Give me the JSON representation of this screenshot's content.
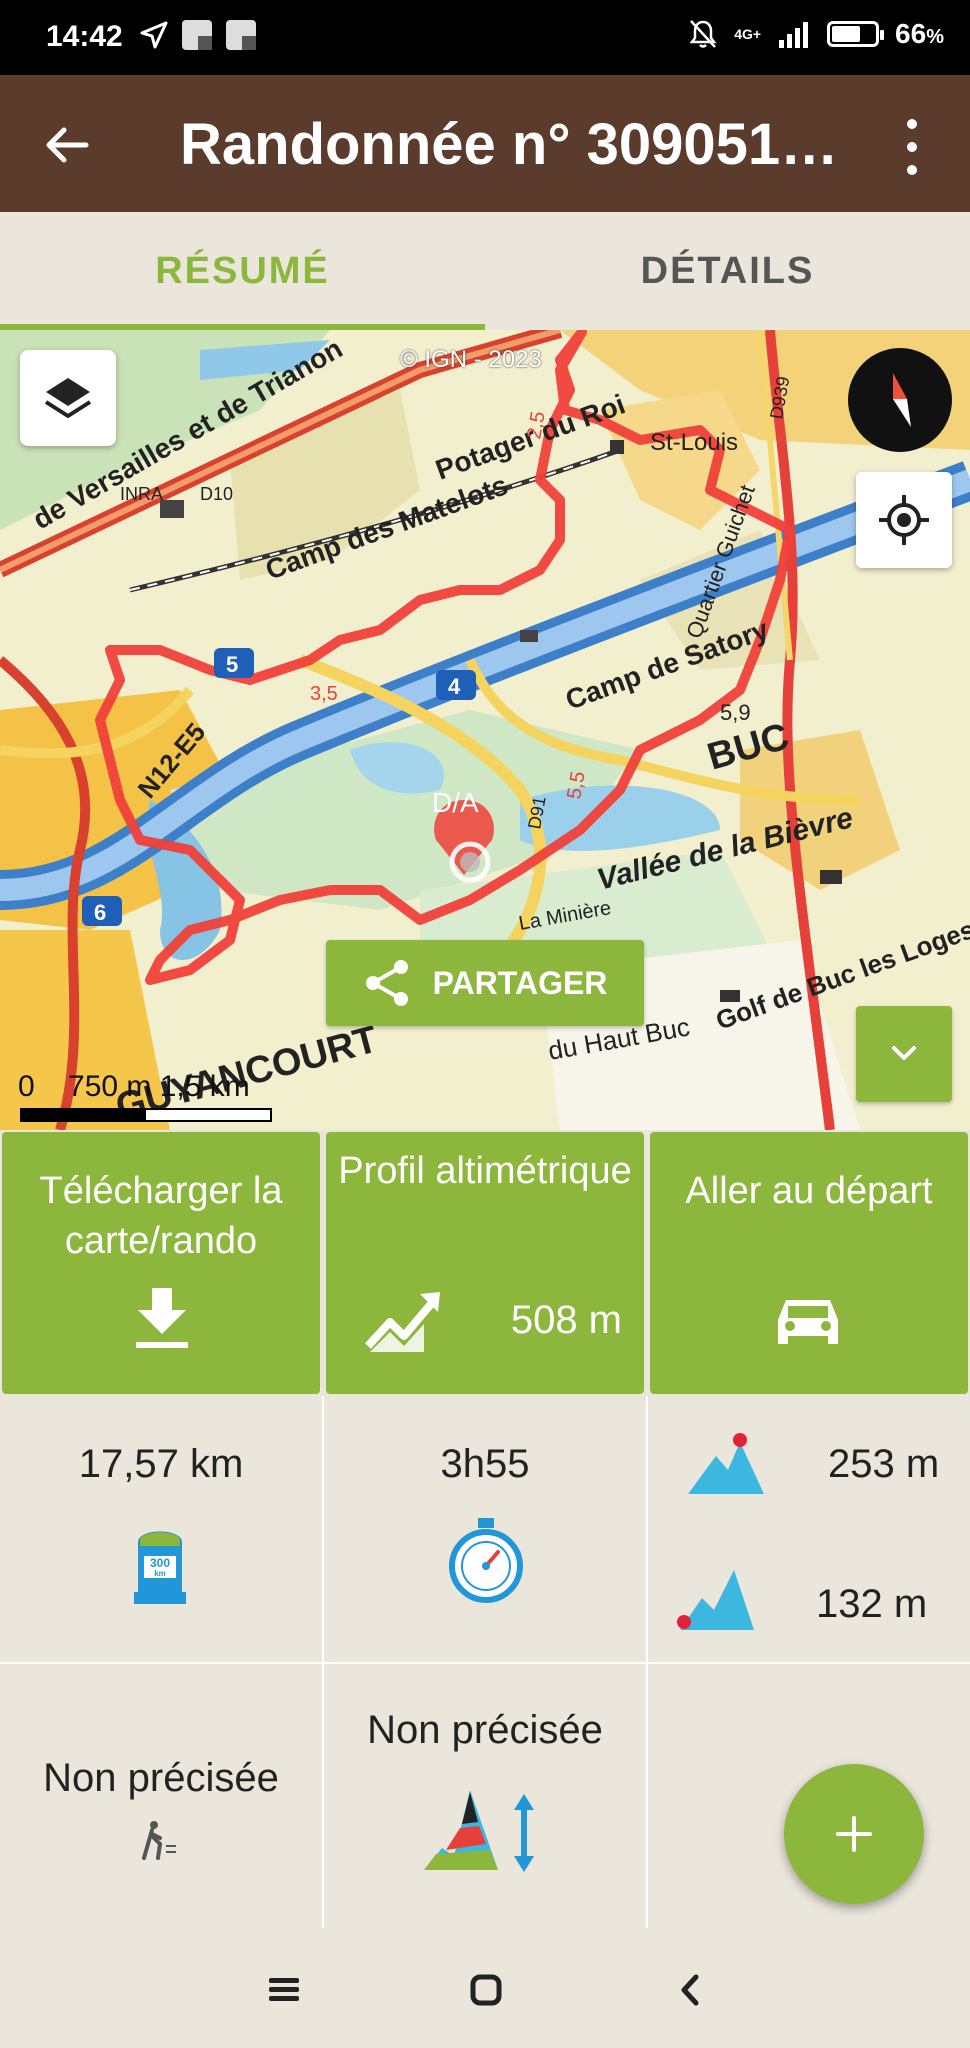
{
  "status_bar": {
    "time": "14:42",
    "network": "4G+",
    "battery": "66",
    "battery_unit": "%"
  },
  "app_bar": {
    "title": "Randonnée n° 309051…"
  },
  "tabs": [
    {
      "label": "RÉSUMÉ",
      "active": true
    },
    {
      "label": "DÉTAILS",
      "active": false
    }
  ],
  "map": {
    "copyright": "© IGN - 2023",
    "start_marker": "D/A",
    "share_label": "PARTAGER",
    "scale_labels": "0    750 m 1,5 km",
    "place_labels": [
      "Potager du Roi",
      "Camp des Matelots",
      "Camp de Satory",
      "BUC",
      "Vallée de la Bièvre",
      "N12-E5",
      "Golf de Buc les Loges",
      "du Haut Buc",
      "La Minière",
      "de Versailles et de Trianon",
      "GUYANCOURT",
      "St-Louis",
      "Quartier Guichet",
      "INRA",
      "D10",
      "D91",
      "D939",
      "5,9",
      "5,5",
      "3,5",
      "2,5",
      "4",
      "5",
      "6"
    ]
  },
  "tiles": [
    {
      "label": "Télécharger la carte/rando",
      "icon": "download-icon"
    },
    {
      "label": "Profil altimétrique",
      "icon": "elevation-chart-icon",
      "value": "508 m"
    },
    {
      "label": "Aller au départ",
      "icon": "car-icon"
    }
  ],
  "stats": {
    "distance": "17,57 km",
    "duration": "3h55",
    "ascent": "253 m",
    "descent": "132 m",
    "activity": "Non précisée",
    "difficulty": "Non précisée",
    "distance_badge": "300",
    "distance_badge_unit": "km"
  },
  "colors": {
    "brand_green": "#8db63c",
    "header_brown": "#5b3b2c",
    "background": "#ebe6dc",
    "track_red": "#f0403a"
  }
}
